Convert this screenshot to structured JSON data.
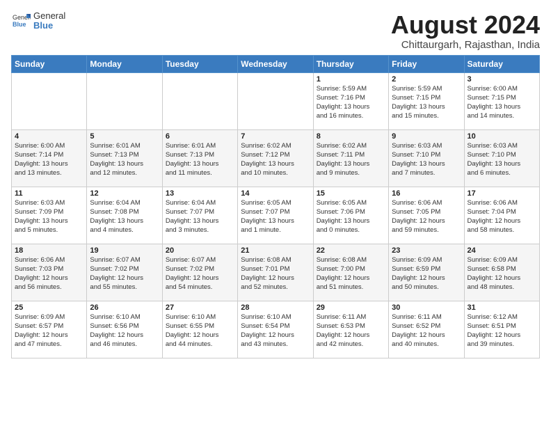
{
  "logo": {
    "general": "General",
    "blue": "Blue"
  },
  "title": "August 2024",
  "subtitle": "Chittaurgarh, Rajasthan, India",
  "days_of_week": [
    "Sunday",
    "Monday",
    "Tuesday",
    "Wednesday",
    "Thursday",
    "Friday",
    "Saturday"
  ],
  "weeks": [
    {
      "alt": false,
      "days": [
        {
          "num": "",
          "info": ""
        },
        {
          "num": "",
          "info": ""
        },
        {
          "num": "",
          "info": ""
        },
        {
          "num": "",
          "info": ""
        },
        {
          "num": "1",
          "info": "Sunrise: 5:59 AM\nSunset: 7:16 PM\nDaylight: 13 hours\nand 16 minutes."
        },
        {
          "num": "2",
          "info": "Sunrise: 5:59 AM\nSunset: 7:15 PM\nDaylight: 13 hours\nand 15 minutes."
        },
        {
          "num": "3",
          "info": "Sunrise: 6:00 AM\nSunset: 7:15 PM\nDaylight: 13 hours\nand 14 minutes."
        }
      ]
    },
    {
      "alt": true,
      "days": [
        {
          "num": "4",
          "info": "Sunrise: 6:00 AM\nSunset: 7:14 PM\nDaylight: 13 hours\nand 13 minutes."
        },
        {
          "num": "5",
          "info": "Sunrise: 6:01 AM\nSunset: 7:13 PM\nDaylight: 13 hours\nand 12 minutes."
        },
        {
          "num": "6",
          "info": "Sunrise: 6:01 AM\nSunset: 7:13 PM\nDaylight: 13 hours\nand 11 minutes."
        },
        {
          "num": "7",
          "info": "Sunrise: 6:02 AM\nSunset: 7:12 PM\nDaylight: 13 hours\nand 10 minutes."
        },
        {
          "num": "8",
          "info": "Sunrise: 6:02 AM\nSunset: 7:11 PM\nDaylight: 13 hours\nand 9 minutes."
        },
        {
          "num": "9",
          "info": "Sunrise: 6:03 AM\nSunset: 7:10 PM\nDaylight: 13 hours\nand 7 minutes."
        },
        {
          "num": "10",
          "info": "Sunrise: 6:03 AM\nSunset: 7:10 PM\nDaylight: 13 hours\nand 6 minutes."
        }
      ]
    },
    {
      "alt": false,
      "days": [
        {
          "num": "11",
          "info": "Sunrise: 6:03 AM\nSunset: 7:09 PM\nDaylight: 13 hours\nand 5 minutes."
        },
        {
          "num": "12",
          "info": "Sunrise: 6:04 AM\nSunset: 7:08 PM\nDaylight: 13 hours\nand 4 minutes."
        },
        {
          "num": "13",
          "info": "Sunrise: 6:04 AM\nSunset: 7:07 PM\nDaylight: 13 hours\nand 3 minutes."
        },
        {
          "num": "14",
          "info": "Sunrise: 6:05 AM\nSunset: 7:07 PM\nDaylight: 13 hours\nand 1 minute."
        },
        {
          "num": "15",
          "info": "Sunrise: 6:05 AM\nSunset: 7:06 PM\nDaylight: 13 hours\nand 0 minutes."
        },
        {
          "num": "16",
          "info": "Sunrise: 6:06 AM\nSunset: 7:05 PM\nDaylight: 12 hours\nand 59 minutes."
        },
        {
          "num": "17",
          "info": "Sunrise: 6:06 AM\nSunset: 7:04 PM\nDaylight: 12 hours\nand 58 minutes."
        }
      ]
    },
    {
      "alt": true,
      "days": [
        {
          "num": "18",
          "info": "Sunrise: 6:06 AM\nSunset: 7:03 PM\nDaylight: 12 hours\nand 56 minutes."
        },
        {
          "num": "19",
          "info": "Sunrise: 6:07 AM\nSunset: 7:02 PM\nDaylight: 12 hours\nand 55 minutes."
        },
        {
          "num": "20",
          "info": "Sunrise: 6:07 AM\nSunset: 7:02 PM\nDaylight: 12 hours\nand 54 minutes."
        },
        {
          "num": "21",
          "info": "Sunrise: 6:08 AM\nSunset: 7:01 PM\nDaylight: 12 hours\nand 52 minutes."
        },
        {
          "num": "22",
          "info": "Sunrise: 6:08 AM\nSunset: 7:00 PM\nDaylight: 12 hours\nand 51 minutes."
        },
        {
          "num": "23",
          "info": "Sunrise: 6:09 AM\nSunset: 6:59 PM\nDaylight: 12 hours\nand 50 minutes."
        },
        {
          "num": "24",
          "info": "Sunrise: 6:09 AM\nSunset: 6:58 PM\nDaylight: 12 hours\nand 48 minutes."
        }
      ]
    },
    {
      "alt": false,
      "days": [
        {
          "num": "25",
          "info": "Sunrise: 6:09 AM\nSunset: 6:57 PM\nDaylight: 12 hours\nand 47 minutes."
        },
        {
          "num": "26",
          "info": "Sunrise: 6:10 AM\nSunset: 6:56 PM\nDaylight: 12 hours\nand 46 minutes."
        },
        {
          "num": "27",
          "info": "Sunrise: 6:10 AM\nSunset: 6:55 PM\nDaylight: 12 hours\nand 44 minutes."
        },
        {
          "num": "28",
          "info": "Sunrise: 6:10 AM\nSunset: 6:54 PM\nDaylight: 12 hours\nand 43 minutes."
        },
        {
          "num": "29",
          "info": "Sunrise: 6:11 AM\nSunset: 6:53 PM\nDaylight: 12 hours\nand 42 minutes."
        },
        {
          "num": "30",
          "info": "Sunrise: 6:11 AM\nSunset: 6:52 PM\nDaylight: 12 hours\nand 40 minutes."
        },
        {
          "num": "31",
          "info": "Sunrise: 6:12 AM\nSunset: 6:51 PM\nDaylight: 12 hours\nand 39 minutes."
        }
      ]
    }
  ]
}
